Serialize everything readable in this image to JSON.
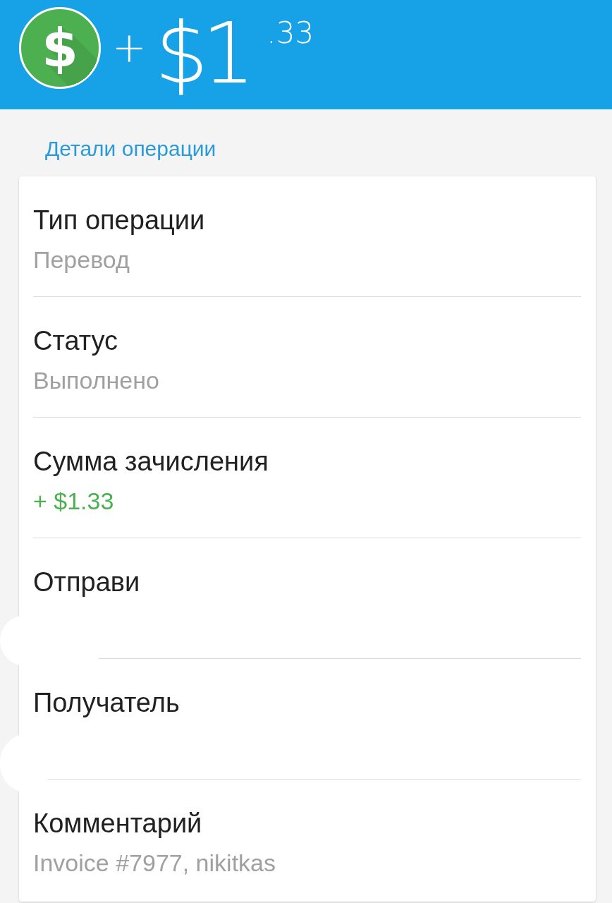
{
  "header": {
    "badge": "$",
    "sign": "+",
    "whole": "$1",
    "cents": ".33"
  },
  "section_title": "Детали операции",
  "details": [
    {
      "label": "Тип операции",
      "value": "Перевод",
      "kind": "plain"
    },
    {
      "label": "Статус",
      "value": "Выполнено",
      "kind": "plain"
    },
    {
      "label": "Сумма зачисления",
      "value": "+ $1.33",
      "kind": "credit"
    },
    {
      "label": "Отправи"
    },
    {
      "label": "Получатель"
    },
    {
      "label": "Комментарий",
      "value": "Invoice #7977, nikitkas",
      "kind": "plain"
    }
  ]
}
